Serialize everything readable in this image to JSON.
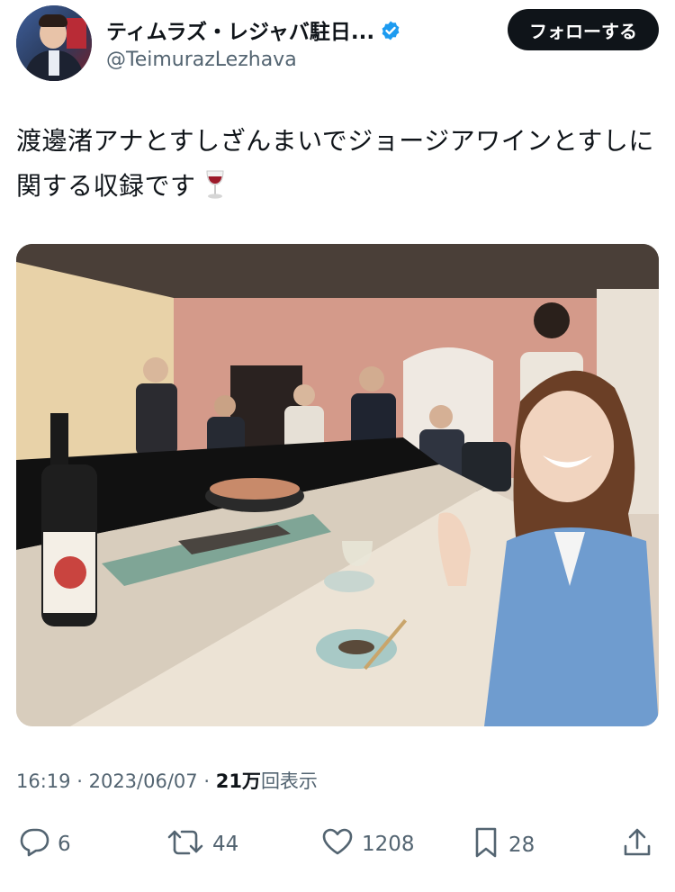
{
  "author": {
    "display_name": "ティムラズ・レジャバ駐日...",
    "handle": "@TeimurazLezhava",
    "verified_icon": "verified-badge-icon",
    "follow_label": "フォローする"
  },
  "tweet": {
    "text": "渡邊渚アナとすしざんまいでジョージアワインとすしに関する収録です",
    "emoji": "wine-glass-icon",
    "image_label": "sushi-counter-recording-photo"
  },
  "meta": {
    "time": "16:19",
    "sep": "·",
    "date": "2023/06/07",
    "views_number": "21万",
    "views_suffix": "回表示"
  },
  "actions": {
    "reply_count": "6",
    "retweet_count": "44",
    "like_count": "1208",
    "bookmark_count": "28"
  },
  "colors": {
    "text_primary": "#0f1419",
    "text_secondary": "#536471",
    "verified_blue": "#1d9bf0",
    "follow_bg": "#0f1419"
  }
}
